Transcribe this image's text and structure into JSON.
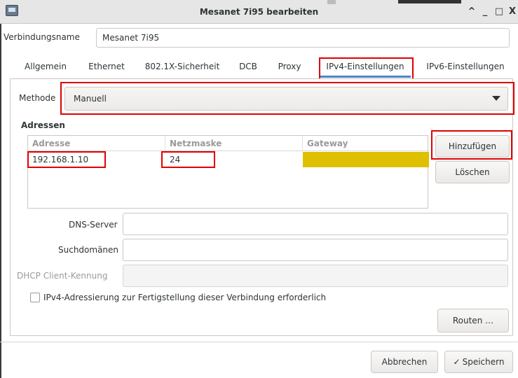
{
  "window": {
    "title": "Mesanet 7i95 bearbeiten",
    "controls": {
      "rollup": "^",
      "minimize": "_",
      "maximize": "□",
      "close": "X"
    }
  },
  "connection_name": {
    "label": "Verbindungsname",
    "value": "Mesanet 7i95"
  },
  "tabs": [
    {
      "label": "Allgemein"
    },
    {
      "label": "Ethernet"
    },
    {
      "label": "802.1X-Sicherheit"
    },
    {
      "label": "DCB"
    },
    {
      "label": "Proxy"
    },
    {
      "label": "IPv4-Einstellungen",
      "active": true
    },
    {
      "label": "IPv6-Einstellungen"
    }
  ],
  "method": {
    "label": "Methode",
    "value": "Manuell"
  },
  "addresses": {
    "title": "Adressen",
    "columns": [
      "Adresse",
      "Netzmaske",
      "Gateway"
    ],
    "rows": [
      {
        "address": "192.168.1.10",
        "netmask": "24",
        "gateway": ""
      }
    ],
    "add_button": "Hinzufügen",
    "delete_button": "Löschen"
  },
  "fields": {
    "dns": {
      "label": "DNS-Server",
      "value": ""
    },
    "search_domains": {
      "label": "Suchdomänen",
      "value": ""
    },
    "dhcp_client_id": {
      "label": "DHCP Client-Kennung",
      "value": ""
    }
  },
  "require_ipv4": {
    "label": "IPv4-Adressierung zur Fertigstellung dieser Verbindung erforderlich",
    "checked": false
  },
  "routes_button": "Routen …",
  "footer": {
    "cancel": "Abbrechen",
    "save_icon": "✓",
    "save": "Speichern"
  },
  "colors": {
    "highlight": "#e00000",
    "gateway_cell": "#dfc000",
    "active_tab": "#4a86c8"
  }
}
